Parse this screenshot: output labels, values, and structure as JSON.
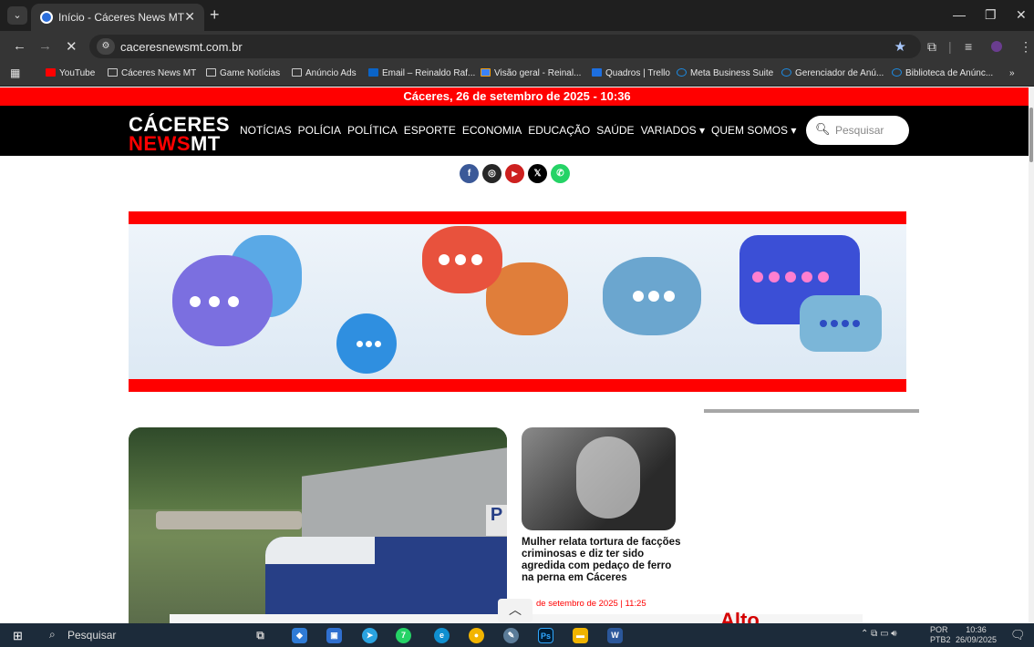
{
  "browser": {
    "tab_title": "Início - Cáceres News MT",
    "url": "caceresnewsmt.com.br",
    "bookmarks": [
      {
        "label": "YouTube"
      },
      {
        "label": "Cáceres News MT"
      },
      {
        "label": "Game Notícias"
      },
      {
        "label": "Anúncio Ads"
      },
      {
        "label": "Email – Reinaldo Raf..."
      },
      {
        "label": "Visão geral - Reinal..."
      },
      {
        "label": "Quadros | Trello"
      },
      {
        "label": "Meta Business Suite"
      },
      {
        "label": "Gerenciador de Anú..."
      },
      {
        "label": "Biblioteca de Anúnc..."
      }
    ],
    "accent_color": "#a8c7fa"
  },
  "site": {
    "date_bar": "Cáceres, 26 de setembro de 2025 - 10:36",
    "logo_line1": "CÁCERES",
    "logo_news": "NEWS",
    "logo_mt": "MT",
    "nav": [
      "NOTÍCIAS",
      "POLÍCIA",
      "POLÍTICA",
      "ESPORTE",
      "ECONOMIA",
      "EDUCAÇÃO",
      "SAÚDE",
      "VARIADOS ▾",
      "QUEM SOMOS ▾"
    ],
    "search_placeholder": "Pesquisar",
    "social": [
      {
        "icon": "facebook-icon",
        "glyph": "f",
        "color": "#3b5998"
      },
      {
        "icon": "instagram-icon",
        "glyph": "◎",
        "color": "#262626"
      },
      {
        "icon": "youtube-icon",
        "glyph": "▶",
        "color": "#cd201f"
      },
      {
        "icon": "x-icon",
        "glyph": "𝕏",
        "color": "#000000"
      },
      {
        "icon": "whatsapp-icon",
        "glyph": "✆",
        "color": "#25d366"
      }
    ],
    "brand_red": "#ff0000",
    "side_article": {
      "title": "Mulher relata tortura de facções criminosas e diz ter sido agredida com pedaço de ferro na perna em Cáceres",
      "date": "de setembro de 2025 | 11:25"
    },
    "promo_fragment": "Alto"
  },
  "taskbar": {
    "search": "Pesquisar",
    "lang_line1": "POR",
    "lang_line2": "PTB2",
    "time": "10:36",
    "date": "26/09/2025",
    "whatsapp_badge": "7"
  }
}
